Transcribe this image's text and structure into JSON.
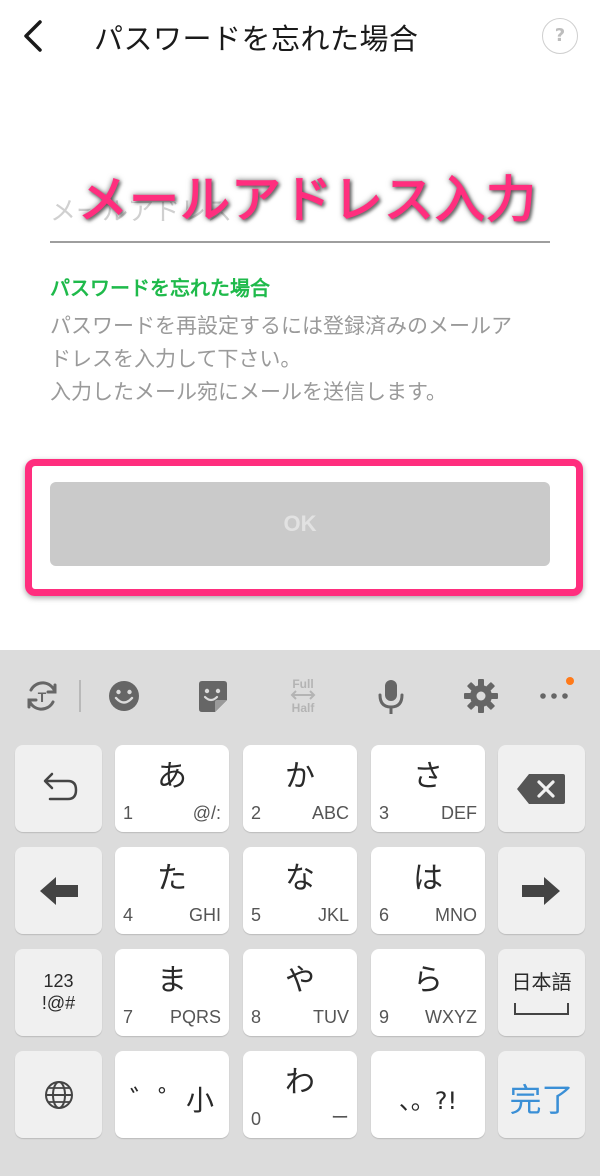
{
  "header": {
    "title": "パスワードを忘れた場合",
    "help_label": "?"
  },
  "form": {
    "email_placeholder": "メールアドレス",
    "overlay_caption": "メールアドレス入力",
    "section_title": "パスワードを忘れた場合",
    "description_lines": [
      "パスワードを再設定するには登録済みのメールア",
      "ドレスを入力して下さい。",
      "入力したメール宛にメールを送信します。"
    ],
    "ok_label": "OK"
  },
  "keyboard": {
    "toolbar": {
      "full": "Full",
      "half": "Half"
    },
    "keys": {
      "a": {
        "main": "あ",
        "num": "1",
        "sub": "@/:"
      },
      "ka": {
        "main": "か",
        "num": "2",
        "sub": "ABC"
      },
      "sa": {
        "main": "さ",
        "num": "3",
        "sub": "DEF"
      },
      "ta": {
        "main": "た",
        "num": "4",
        "sub": "GHI"
      },
      "na": {
        "main": "な",
        "num": "5",
        "sub": "JKL"
      },
      "ha": {
        "main": "は",
        "num": "6",
        "sub": "MNO"
      },
      "ma": {
        "main": "ま",
        "num": "7",
        "sub": "PQRS"
      },
      "ya": {
        "main": "や",
        "num": "8",
        "sub": "TUV"
      },
      "ra": {
        "main": "ら",
        "num": "9",
        "sub": "WXYZ"
      },
      "dakuten": {
        "main": "゛゜小"
      },
      "wa": {
        "main": "わ",
        "num": "0",
        "sub": "ー"
      },
      "punct": {
        "main": "、。?!"
      },
      "symbols": {
        "line1": "123",
        "line2": "!@#"
      },
      "lang": {
        "label": "日本語"
      },
      "done": {
        "label": "完了"
      }
    }
  },
  "colors": {
    "accent_pink": "#ff2e7e",
    "section_green": "#1fba4b",
    "done_blue": "#3a8fd6",
    "notification_orange": "#ff7a1a"
  }
}
